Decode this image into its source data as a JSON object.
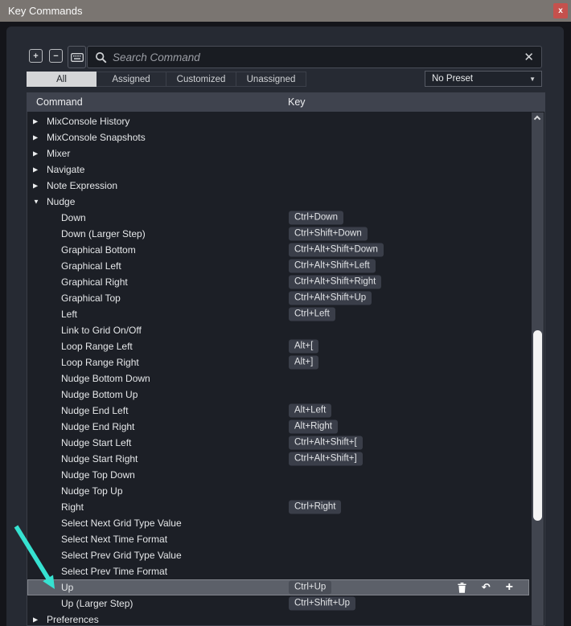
{
  "window": {
    "title": "Key Commands",
    "close_glyph": "x"
  },
  "toolbar": {
    "search_placeholder": "Search Command",
    "expand_all_glyph": "+",
    "collapse_all_glyph": "−",
    "clear_glyph": "✕"
  },
  "filter_tabs": [
    {
      "label": "All",
      "selected": true
    },
    {
      "label": "Assigned",
      "selected": false
    },
    {
      "label": "Customized",
      "selected": false
    },
    {
      "label": "Unassigned",
      "selected": false
    }
  ],
  "preset_dropdown": {
    "value": "No Preset"
  },
  "table": {
    "columns": [
      "Command",
      "Key"
    ],
    "rows": [
      {
        "label": "MixConsole History",
        "type": "group",
        "expanded": false,
        "key": ""
      },
      {
        "label": "MixConsole Snapshots",
        "type": "group",
        "expanded": false,
        "key": ""
      },
      {
        "label": "Mixer",
        "type": "group",
        "expanded": false,
        "key": ""
      },
      {
        "label": "Navigate",
        "type": "group",
        "expanded": false,
        "key": ""
      },
      {
        "label": "Note Expression",
        "type": "group",
        "expanded": false,
        "key": ""
      },
      {
        "label": "Nudge",
        "type": "group",
        "expanded": true,
        "key": ""
      },
      {
        "label": "Down",
        "type": "command",
        "key": "Ctrl+Down"
      },
      {
        "label": "Down (Larger Step)",
        "type": "command",
        "key": "Ctrl+Shift+Down"
      },
      {
        "label": "Graphical Bottom",
        "type": "command",
        "key": "Ctrl+Alt+Shift+Down"
      },
      {
        "label": "Graphical Left",
        "type": "command",
        "key": "Ctrl+Alt+Shift+Left"
      },
      {
        "label": "Graphical Right",
        "type": "command",
        "key": "Ctrl+Alt+Shift+Right"
      },
      {
        "label": "Graphical Top",
        "type": "command",
        "key": "Ctrl+Alt+Shift+Up"
      },
      {
        "label": "Left",
        "type": "command",
        "key": "Ctrl+Left"
      },
      {
        "label": "Link to Grid On/Off",
        "type": "command",
        "key": ""
      },
      {
        "label": "Loop Range Left",
        "type": "command",
        "key": "Alt+["
      },
      {
        "label": "Loop Range Right",
        "type": "command",
        "key": "Alt+]"
      },
      {
        "label": "Nudge Bottom Down",
        "type": "command",
        "key": ""
      },
      {
        "label": "Nudge Bottom Up",
        "type": "command",
        "key": ""
      },
      {
        "label": "Nudge End Left",
        "type": "command",
        "key": "Alt+Left"
      },
      {
        "label": "Nudge End Right",
        "type": "command",
        "key": "Alt+Right"
      },
      {
        "label": "Nudge Start Left",
        "type": "command",
        "key": "Ctrl+Alt+Shift+["
      },
      {
        "label": "Nudge Start Right",
        "type": "command",
        "key": "Ctrl+Alt+Shift+]"
      },
      {
        "label": "Nudge Top Down",
        "type": "command",
        "key": ""
      },
      {
        "label": "Nudge Top Up",
        "type": "command",
        "key": ""
      },
      {
        "label": "Right",
        "type": "command",
        "key": "Ctrl+Right"
      },
      {
        "label": "Select Next Grid Type Value",
        "type": "command",
        "key": ""
      },
      {
        "label": "Select Next Time Format",
        "type": "command",
        "key": ""
      },
      {
        "label": "Select Prev Grid Type Value",
        "type": "command",
        "key": ""
      },
      {
        "label": "Select Prev Time Format",
        "type": "command",
        "key": ""
      },
      {
        "label": "Up",
        "type": "command",
        "key": "Ctrl+Up",
        "selected": true
      },
      {
        "label": "Up (Larger Step)",
        "type": "command",
        "key": "Ctrl+Shift+Up"
      },
      {
        "label": "Preferences",
        "type": "group",
        "expanded": false,
        "key": ""
      }
    ]
  },
  "selected_row_actions": [
    "delete-icon",
    "undo-icon",
    "add-icon"
  ],
  "colors": {
    "titlebar": "#7a7571",
    "close_button": "#c5514d",
    "dialog_bg": "#262a33",
    "list_bg": "#1c1f26",
    "header_bg": "#3f434e",
    "key_badge_bg": "#3a3e49",
    "selected_row_bg": "#5c6069",
    "selected_tab_bg": "#d5d6d8",
    "scroll_thumb": "#f4f4f4",
    "annotation_arrow": "#36e2d1"
  }
}
